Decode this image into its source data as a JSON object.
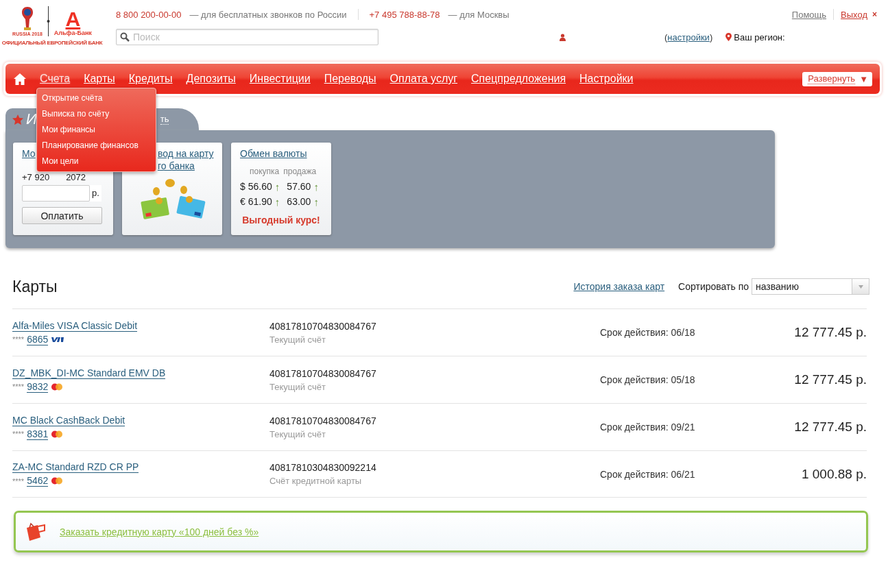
{
  "logo": {
    "event": "RUSSIA 2018",
    "bank_letter": "А",
    "bank": "Альфа-Банк",
    "tagline": "ОФИЦИАЛЬНЫЙ ЕВРОПЕЙСКИЙ БАНК"
  },
  "contacts": [
    {
      "phone": "8 800 200-00-00",
      "note": "— для бесплатных звонков по России"
    },
    {
      "phone": "+7 495 788-88-78",
      "note": "— для Москвы"
    }
  ],
  "search": {
    "placeholder": "Поиск"
  },
  "user": {
    "settings_open": "(",
    "settings": "настройки",
    "settings_close": ")",
    "region": "Ваш регион:"
  },
  "top_links": [
    {
      "label": "Помощь",
      "kind": "help"
    },
    {
      "label": "Выход",
      "kind": "logout"
    }
  ],
  "logout_mark": "×",
  "nav": {
    "items": [
      {
        "label": "Счета",
        "selected": true
      },
      {
        "label": "Карты",
        "selected": false
      },
      {
        "label": "Кредиты",
        "selected": false
      },
      {
        "label": "Депозиты",
        "selected": false
      },
      {
        "label": "Инвестиции",
        "selected": false
      },
      {
        "label": "Переводы",
        "selected": false
      },
      {
        "label": "Оплата услуг",
        "selected": false
      },
      {
        "label": "Спецпредложения",
        "selected": false
      },
      {
        "label": "Настройки",
        "selected": false
      }
    ],
    "expand": "Развернуть",
    "expand_mark": "▼"
  },
  "dropdown": [
    "Открытие счёта",
    "Выписка по счёту",
    "Мои финансы",
    "Планирование финансов",
    "Мои цели"
  ],
  "widgets": {
    "title": "И",
    "edit": "ть",
    "mobile": {
      "title": "Мо",
      "phone_start": "+7 920",
      "phone_end": "2072",
      "currency": "р.",
      "button": "Оплатить"
    },
    "transfer": {
      "title": [
        "вод на карту",
        "го банка"
      ]
    },
    "exchange": {
      "title": "Обмен валюты",
      "columns": [
        "покупка",
        "продажа"
      ],
      "rates": [
        {
          "symbol": "$",
          "buy": "56.60",
          "buy_arrow": "↑",
          "sell": "57.60",
          "sell_arrow": "↑"
        },
        {
          "symbol": "€",
          "buy": "61.90",
          "buy_arrow": "↑",
          "sell": "63.00",
          "sell_arrow": "↑"
        }
      ],
      "promo": "Выгодный курс!"
    }
  },
  "cards": {
    "title": "Карты",
    "history": "История заказа карт",
    "sort_label": "Сортировать по",
    "sort_value": "названию",
    "rows": [
      {
        "name": "Alfa-Miles VISA Classic Debit",
        "mask": "****",
        "last4": "6865",
        "kind": "visa",
        "account": "40817810704830084767",
        "account_type": "Текущий счёт",
        "expiry": "Срок действия: 06/18",
        "balance": "12 777.45 р."
      },
      {
        "name": "DZ_MBK_DI-MC Standard EMV DB",
        "mask": "****",
        "last4": "9832",
        "kind": "mastercard",
        "account": "40817810704830084767",
        "account_type": "Текущий счёт",
        "expiry": "Срок действия: 05/18",
        "balance": "12 777.45 р."
      },
      {
        "name": "MC Black CashBack Debit",
        "mask": "****",
        "last4": "8381",
        "kind": "mastercard",
        "account": "40817810704830084767",
        "account_type": "Текущий счёт",
        "expiry": "Срок действия: 09/21",
        "balance": "12 777.45 р."
      },
      {
        "name": "ZA-MC Standard RZD CR PP",
        "mask": "****",
        "last4": "5462",
        "kind": "mastercard",
        "account": "40817810304830092214",
        "account_type": "Счёт кредитной карты",
        "expiry": "Срок действия: 06/21",
        "balance": "1 000.88 р."
      }
    ]
  },
  "offer": {
    "link": "Заказать кредитную карту «100 дней без %»"
  }
}
